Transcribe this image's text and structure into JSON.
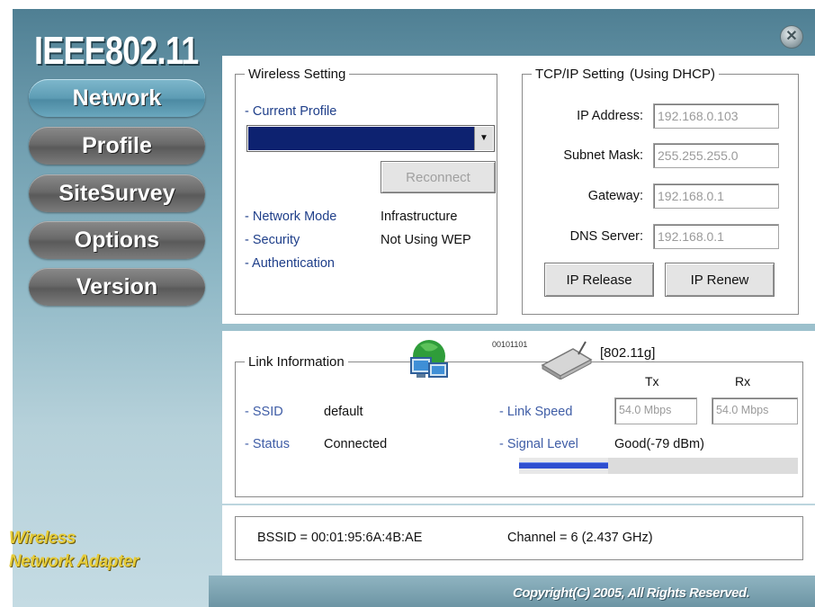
{
  "app": {
    "logo": "IEEE802.11",
    "brand_line1": "Wireless",
    "brand_line2": "Network Adapter",
    "copyright": "Copyright(C) 2005, All Rights Reserved."
  },
  "nav": {
    "items": [
      "Network",
      "Profile",
      "SiteSurvey",
      "Options",
      "Version"
    ],
    "active": "Network"
  },
  "wireless": {
    "title": "Wireless Setting",
    "current_profile_label": "- Current Profile",
    "profile_value": "",
    "reconnect_label": "Reconnect",
    "network_mode_label": "- Network Mode",
    "network_mode_value": "Infrastructure",
    "security_label": "- Security",
    "security_value": "Not Using WEP",
    "authentication_label": "- Authentication"
  },
  "tcpip": {
    "title": "TCP/IP Setting",
    "mode": "(Using DHCP)",
    "ip_label": "IP Address:",
    "ip_value": "192.168.0.103",
    "mask_label": "Subnet Mask:",
    "mask_value": "255.255.255.0",
    "gateway_label": "Gateway:",
    "gateway_value": "192.168.0.1",
    "dns_label": "DNS Server:",
    "dns_value": "192.168.0.1",
    "release_label": "IP Release",
    "renew_label": "IP Renew"
  },
  "link": {
    "title": "Link Information",
    "device_bits": "00101101",
    "standard": "[802.11g]",
    "tx_label": "Tx",
    "rx_label": "Rx",
    "ssid_label": "- SSID",
    "ssid_value": "default",
    "status_label": "- Status",
    "status_value": "Connected",
    "speed_label": "- Link Speed",
    "tx_speed": "54.0 Mbps",
    "rx_speed": "54.0 Mbps",
    "signal_label": "- Signal Level",
    "signal_value": "Good(-79 dBm)",
    "signal_fraction": 0.32,
    "bssid": "BSSID = 00:01:95:6A:4B:AE",
    "channel": "Channel = 6 (2.437 GHz)"
  },
  "colors": {
    "profile_fill": "#0d2270",
    "signal_bar": "#2f4fd0",
    "brand_text": "#e6cc3a"
  }
}
